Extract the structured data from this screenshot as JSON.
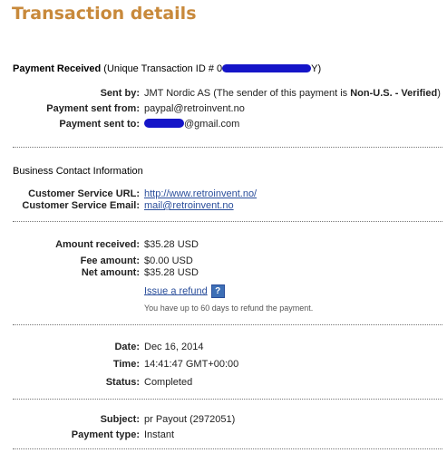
{
  "title": "Transaction details",
  "payment_received": {
    "heading": "Payment Received",
    "id_prefix": "(Unique Transaction ID # 0",
    "id_suffix": "Y)",
    "sent_by_label": "Sent by:",
    "sent_by_value_start": "JMT Nordic AS (The sender of this payment is ",
    "sent_by_value_bold": "Non-U.S. - Verified",
    "sent_by_value_end": ")",
    "sent_from_label": "Payment sent from:",
    "sent_from_value": "paypal@retroinvent.no",
    "sent_to_label": "Payment sent to:",
    "sent_to_suffix": "@gmail.com"
  },
  "business_contact": {
    "heading": "Business Contact Information",
    "url_label": "Customer Service URL:",
    "url_value": "http://www.retroinvent.no/",
    "email_label": "Customer Service Email:",
    "email_value": "mail@retroinvent.no"
  },
  "amounts": {
    "received_label": "Amount received:",
    "received_value": "$35.28 USD",
    "fee_label": "Fee amount:",
    "fee_value": "$0.00 USD",
    "net_label": "Net amount:",
    "net_value": "$35.28 USD",
    "refund_link": "Issue a refund",
    "help_icon": "?",
    "refund_note": "You have up to 60 days to refund the payment."
  },
  "status": {
    "date_label": "Date:",
    "date_value": "Dec 16, 2014",
    "time_label": "Time:",
    "time_value": "14:41:47 GMT+00:00",
    "status_label": "Status:",
    "status_value": "Completed"
  },
  "details": {
    "subject_label": "Subject:",
    "subject_value": "pr Payout (2972051)",
    "type_label": "Payment type:",
    "type_value": "Instant"
  },
  "colors": {
    "title": "#c8893b",
    "link": "#2a4e9b",
    "redaction": "#1515c8"
  }
}
